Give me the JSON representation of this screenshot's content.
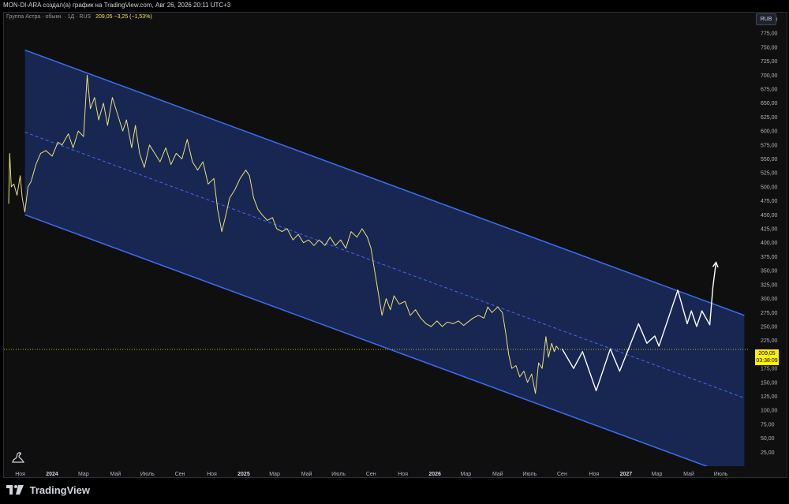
{
  "header": {
    "title": "MON-DI-ARA создал(а) график на TradingView.com, Авг 26, 2026 20:11 UTC+3"
  },
  "legend": {
    "symbol": "Группа Астра · обыкн. · 1Д · RUS",
    "value": "209,05 −3,25 (−1,53%)"
  },
  "currency_button": {
    "label": "RUB"
  },
  "price_tag": {
    "price": "209,05",
    "countdown": "03:38:09"
  },
  "branding": {
    "name": "TradingView"
  },
  "colors": {
    "background": "#0f0f0f",
    "channel_line": "#3d6df2",
    "channel_fill": "#1a2a5e",
    "price_line": "#e8e07a",
    "projection": "#ffffff",
    "price_tag": "#fff200"
  },
  "chart_data": {
    "type": "line",
    "y_unit": "RUB",
    "ylim": [
      0,
      812
    ],
    "xlim": [
      "2023-10-01",
      "2027-08-25"
    ],
    "y_ticks": [
      {
        "v": 25,
        "label": "25,00"
      },
      {
        "v": 50,
        "label": "50,00"
      },
      {
        "v": 75,
        "label": "75,00"
      },
      {
        "v": 100,
        "label": "100,00"
      },
      {
        "v": 125,
        "label": "125,00"
      },
      {
        "v": 150,
        "label": "150,00"
      },
      {
        "v": 175,
        "label": "175,00"
      },
      {
        "v": 200,
        "label": "200,00"
      },
      {
        "v": 225,
        "label": "225,00"
      },
      {
        "v": 250,
        "label": "250,00"
      },
      {
        "v": 275,
        "label": "275,00"
      },
      {
        "v": 300,
        "label": "300,00"
      },
      {
        "v": 325,
        "label": "325,00"
      },
      {
        "v": 350,
        "label": "350,00"
      },
      {
        "v": 375,
        "label": "375,00"
      },
      {
        "v": 400,
        "label": "400,00"
      },
      {
        "v": 425,
        "label": "425,00"
      },
      {
        "v": 450,
        "label": "450,00"
      },
      {
        "v": 475,
        "label": "475,00"
      },
      {
        "v": 500,
        "label": "500,00"
      },
      {
        "v": 525,
        "label": "525,00"
      },
      {
        "v": 550,
        "label": "550,00"
      },
      {
        "v": 575,
        "label": "575,00"
      },
      {
        "v": 600,
        "label": "600,00"
      },
      {
        "v": 625,
        "label": "625,00"
      },
      {
        "v": 650,
        "label": "650,00"
      },
      {
        "v": 675,
        "label": "675,00"
      },
      {
        "v": 700,
        "label": "700,00"
      },
      {
        "v": 725,
        "label": "725,00"
      },
      {
        "v": 750,
        "label": "750,00"
      },
      {
        "v": 775,
        "label": "775,00"
      },
      {
        "v": 800,
        "label": "800,00"
      }
    ],
    "x_ticks": [
      {
        "d": "2023-11-01",
        "label": "Ноя"
      },
      {
        "d": "2024-01-01",
        "label": "2024",
        "bold": true
      },
      {
        "d": "2024-03-01",
        "label": "Мар"
      },
      {
        "d": "2024-05-01",
        "label": "Май"
      },
      {
        "d": "2024-07-01",
        "label": "Июль"
      },
      {
        "d": "2024-09-01",
        "label": "Сен"
      },
      {
        "d": "2024-11-01",
        "label": "Ноя"
      },
      {
        "d": "2025-01-01",
        "label": "2025",
        "bold": true
      },
      {
        "d": "2025-03-01",
        "label": "Мар"
      },
      {
        "d": "2025-05-01",
        "label": "Май"
      },
      {
        "d": "2025-07-01",
        "label": "Июль"
      },
      {
        "d": "2025-09-01",
        "label": "Сен"
      },
      {
        "d": "2025-11-01",
        "label": "Ноя"
      },
      {
        "d": "2026-01-01",
        "label": "2026",
        "bold": true
      },
      {
        "d": "2026-03-01",
        "label": "Мар"
      },
      {
        "d": "2026-05-01",
        "label": "Май"
      },
      {
        "d": "2026-07-01",
        "label": "Июль"
      },
      {
        "d": "2026-09-01",
        "label": "Сен"
      },
      {
        "d": "2026-11-01",
        "label": "Ноя"
      },
      {
        "d": "2027-01-01",
        "label": "2027",
        "bold": true
      },
      {
        "d": "2027-03-01",
        "label": "Мар"
      },
      {
        "d": "2027-05-01",
        "label": "Май"
      },
      {
        "d": "2027-07-01",
        "label": "Июль"
      }
    ],
    "current_price": 209.05,
    "channel": {
      "upper": [
        [
          "2023-11-10",
          745
        ],
        [
          "2027-08-15",
          270
        ]
      ],
      "lower": [
        [
          "2023-11-10",
          450
        ],
        [
          "2027-08-15",
          -25
        ]
      ],
      "middle": [
        [
          "2023-11-10",
          598
        ],
        [
          "2027-08-15",
          122
        ]
      ]
    },
    "series": [
      {
        "key": "price",
        "points": [
          [
            "2023-10-10",
            470
          ],
          [
            "2023-10-12",
            560
          ],
          [
            "2023-10-15",
            500
          ],
          [
            "2023-10-20",
            505
          ],
          [
            "2023-10-26",
            485
          ],
          [
            "2023-11-01",
            520
          ],
          [
            "2023-11-05",
            480
          ],
          [
            "2023-11-10",
            455
          ],
          [
            "2023-11-16",
            500
          ],
          [
            "2023-11-22",
            510
          ],
          [
            "2023-12-01",
            540
          ],
          [
            "2023-12-10",
            560
          ],
          [
            "2023-12-20",
            565
          ],
          [
            "2024-01-01",
            555
          ],
          [
            "2024-01-12",
            580
          ],
          [
            "2024-01-20",
            575
          ],
          [
            "2024-02-01",
            595
          ],
          [
            "2024-02-10",
            570
          ],
          [
            "2024-02-20",
            600
          ],
          [
            "2024-03-01",
            590
          ],
          [
            "2024-03-08",
            700
          ],
          [
            "2024-03-14",
            640
          ],
          [
            "2024-03-22",
            660
          ],
          [
            "2024-03-30",
            620
          ],
          [
            "2024-04-08",
            650
          ],
          [
            "2024-04-16",
            610
          ],
          [
            "2024-04-25",
            660
          ],
          [
            "2024-05-05",
            630
          ],
          [
            "2024-05-15",
            600
          ],
          [
            "2024-05-22",
            620
          ],
          [
            "2024-06-01",
            570
          ],
          [
            "2024-06-08",
            610
          ],
          [
            "2024-06-16",
            560
          ],
          [
            "2024-06-25",
            535
          ],
          [
            "2024-07-05",
            575
          ],
          [
            "2024-07-15",
            560
          ],
          [
            "2024-07-25",
            545
          ],
          [
            "2024-08-05",
            570
          ],
          [
            "2024-08-15",
            540
          ],
          [
            "2024-08-25",
            560
          ],
          [
            "2024-09-05",
            550
          ],
          [
            "2024-09-15",
            585
          ],
          [
            "2024-09-25",
            545
          ],
          [
            "2024-10-05",
            530
          ],
          [
            "2024-10-15",
            545
          ],
          [
            "2024-10-25",
            505
          ],
          [
            "2024-11-05",
            515
          ],
          [
            "2024-11-12",
            460
          ],
          [
            "2024-11-20",
            420
          ],
          [
            "2024-11-28",
            450
          ],
          [
            "2024-12-05",
            480
          ],
          [
            "2024-12-15",
            495
          ],
          [
            "2024-12-25",
            515
          ],
          [
            "2025-01-05",
            530
          ],
          [
            "2025-01-12",
            520
          ],
          [
            "2025-01-20",
            480
          ],
          [
            "2025-01-28",
            460
          ],
          [
            "2025-02-05",
            450
          ],
          [
            "2025-02-15",
            440
          ],
          [
            "2025-02-25",
            445
          ],
          [
            "2025-03-05",
            425
          ],
          [
            "2025-03-15",
            420
          ],
          [
            "2025-03-25",
            425
          ],
          [
            "2025-04-05",
            405
          ],
          [
            "2025-04-15",
            415
          ],
          [
            "2025-04-25",
            400
          ],
          [
            "2025-05-05",
            405
          ],
          [
            "2025-05-15",
            395
          ],
          [
            "2025-05-25",
            405
          ],
          [
            "2025-06-05",
            395
          ],
          [
            "2025-06-15",
            410
          ],
          [
            "2025-06-25",
            395
          ],
          [
            "2025-07-05",
            405
          ],
          [
            "2025-07-15",
            390
          ],
          [
            "2025-07-25",
            420
          ],
          [
            "2025-08-05",
            410
          ],
          [
            "2025-08-15",
            425
          ],
          [
            "2025-08-25",
            410
          ],
          [
            "2025-09-01",
            390
          ],
          [
            "2025-09-08",
            350
          ],
          [
            "2025-09-15",
            310
          ],
          [
            "2025-09-22",
            270
          ],
          [
            "2025-09-30",
            300
          ],
          [
            "2025-10-08",
            280
          ],
          [
            "2025-10-15",
            305
          ],
          [
            "2025-10-25",
            290
          ],
          [
            "2025-11-05",
            295
          ],
          [
            "2025-11-15",
            270
          ],
          [
            "2025-11-25",
            280
          ],
          [
            "2025-12-05",
            265
          ],
          [
            "2025-12-15",
            255
          ],
          [
            "2025-12-25",
            250
          ],
          [
            "2026-01-05",
            260
          ],
          [
            "2026-01-15",
            250
          ],
          [
            "2026-01-25",
            258
          ],
          [
            "2026-02-05",
            255
          ],
          [
            "2026-02-15",
            260
          ],
          [
            "2026-02-25",
            252
          ],
          [
            "2026-03-05",
            258
          ],
          [
            "2026-03-15",
            265
          ],
          [
            "2026-03-25",
            270
          ],
          [
            "2026-04-05",
            265
          ],
          [
            "2026-04-12",
            285
          ],
          [
            "2026-04-20",
            275
          ],
          [
            "2026-05-01",
            285
          ],
          [
            "2026-05-10",
            275
          ],
          [
            "2026-05-16",
            240
          ],
          [
            "2026-05-22",
            200
          ],
          [
            "2026-05-28",
            175
          ],
          [
            "2026-06-05",
            180
          ],
          [
            "2026-06-12",
            160
          ],
          [
            "2026-06-20",
            170
          ],
          [
            "2026-06-27",
            150
          ],
          [
            "2026-07-05",
            165
          ],
          [
            "2026-07-12",
            130
          ],
          [
            "2026-07-18",
            185
          ],
          [
            "2026-07-25",
            175
          ],
          [
            "2026-08-01",
            232
          ],
          [
            "2026-08-06",
            195
          ],
          [
            "2026-08-12",
            220
          ],
          [
            "2026-08-17",
            205
          ],
          [
            "2026-08-21",
            215
          ],
          [
            "2026-08-26",
            209.05
          ]
        ]
      },
      {
        "key": "projection",
        "points": [
          [
            "2026-09-01",
            210
          ],
          [
            "2026-09-23",
            175
          ],
          [
            "2026-10-10",
            205
          ],
          [
            "2026-11-05",
            135
          ],
          [
            "2026-12-02",
            210
          ],
          [
            "2026-12-20",
            170
          ],
          [
            "2027-01-25",
            255
          ],
          [
            "2027-02-10",
            220
          ],
          [
            "2027-02-25",
            233
          ],
          [
            "2027-03-05",
            215
          ],
          [
            "2027-04-10",
            315
          ],
          [
            "2027-04-28",
            255
          ],
          [
            "2027-05-06",
            278
          ],
          [
            "2027-05-16",
            250
          ],
          [
            "2027-05-26",
            278
          ],
          [
            "2027-06-10",
            253
          ],
          [
            "2027-06-16",
            320
          ],
          [
            "2027-06-22",
            365
          ]
        ]
      }
    ]
  }
}
